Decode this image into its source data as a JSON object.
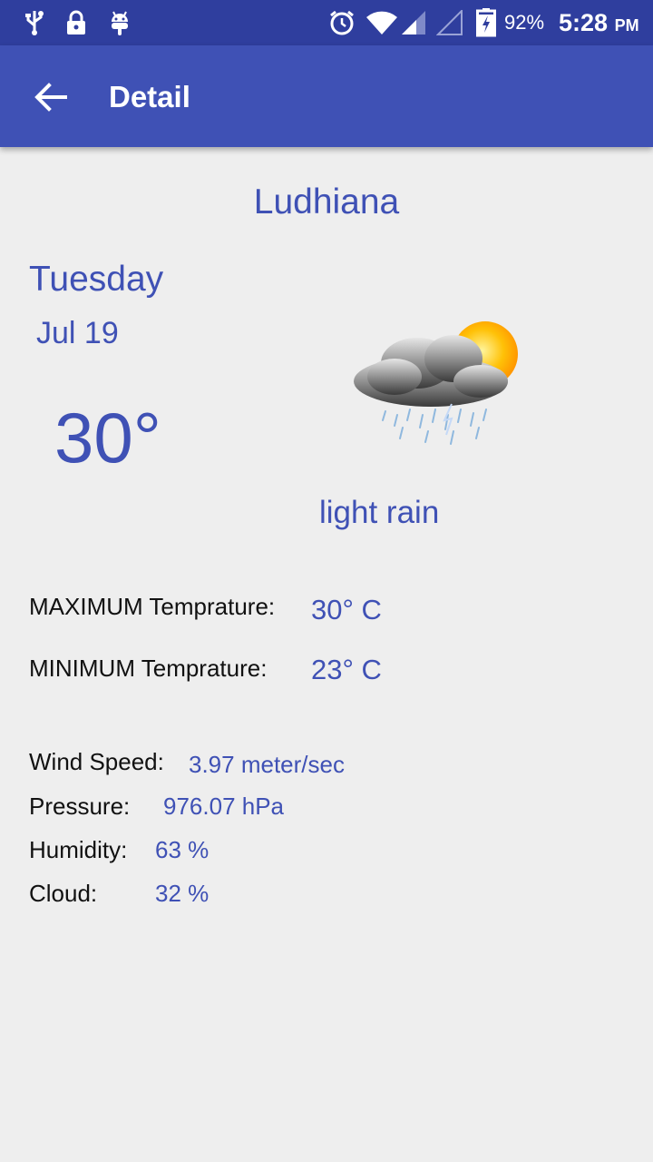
{
  "status_bar": {
    "battery": "92%",
    "time": "5:28",
    "ampm": "PM",
    "icons": [
      "usb-icon",
      "lock-icon",
      "android-icon",
      "alarm-icon",
      "wifi-icon",
      "signal-icon",
      "signal-empty-icon",
      "battery-charging-icon"
    ]
  },
  "app_bar": {
    "title": "Detail",
    "color": "#3f51b5"
  },
  "weather": {
    "city": "Ludhiana",
    "day": "Tuesday",
    "date": "Jul 19",
    "temperature": "30°",
    "condition": "light rain",
    "icon": "cloud-rain-sun-icon",
    "max_label": "MAXIMUM Temprature:",
    "max_value": "30° C",
    "min_label": "MINIMUM Temprature:",
    "min_value": "23° C"
  },
  "details": {
    "wind_label": "Wind Speed:",
    "wind_value": "3.97 meter/sec",
    "pressure_label": "Pressure:",
    "pressure_value": "976.07 hPa",
    "humidity_label": "Humidity:",
    "humidity_value": "63 %",
    "cloud_label": "Cloud:",
    "cloud_value": "32 %"
  },
  "colors": {
    "accent": "#3f51b5",
    "status_bar": "#2f3e9e",
    "background": "#eeeeee"
  }
}
